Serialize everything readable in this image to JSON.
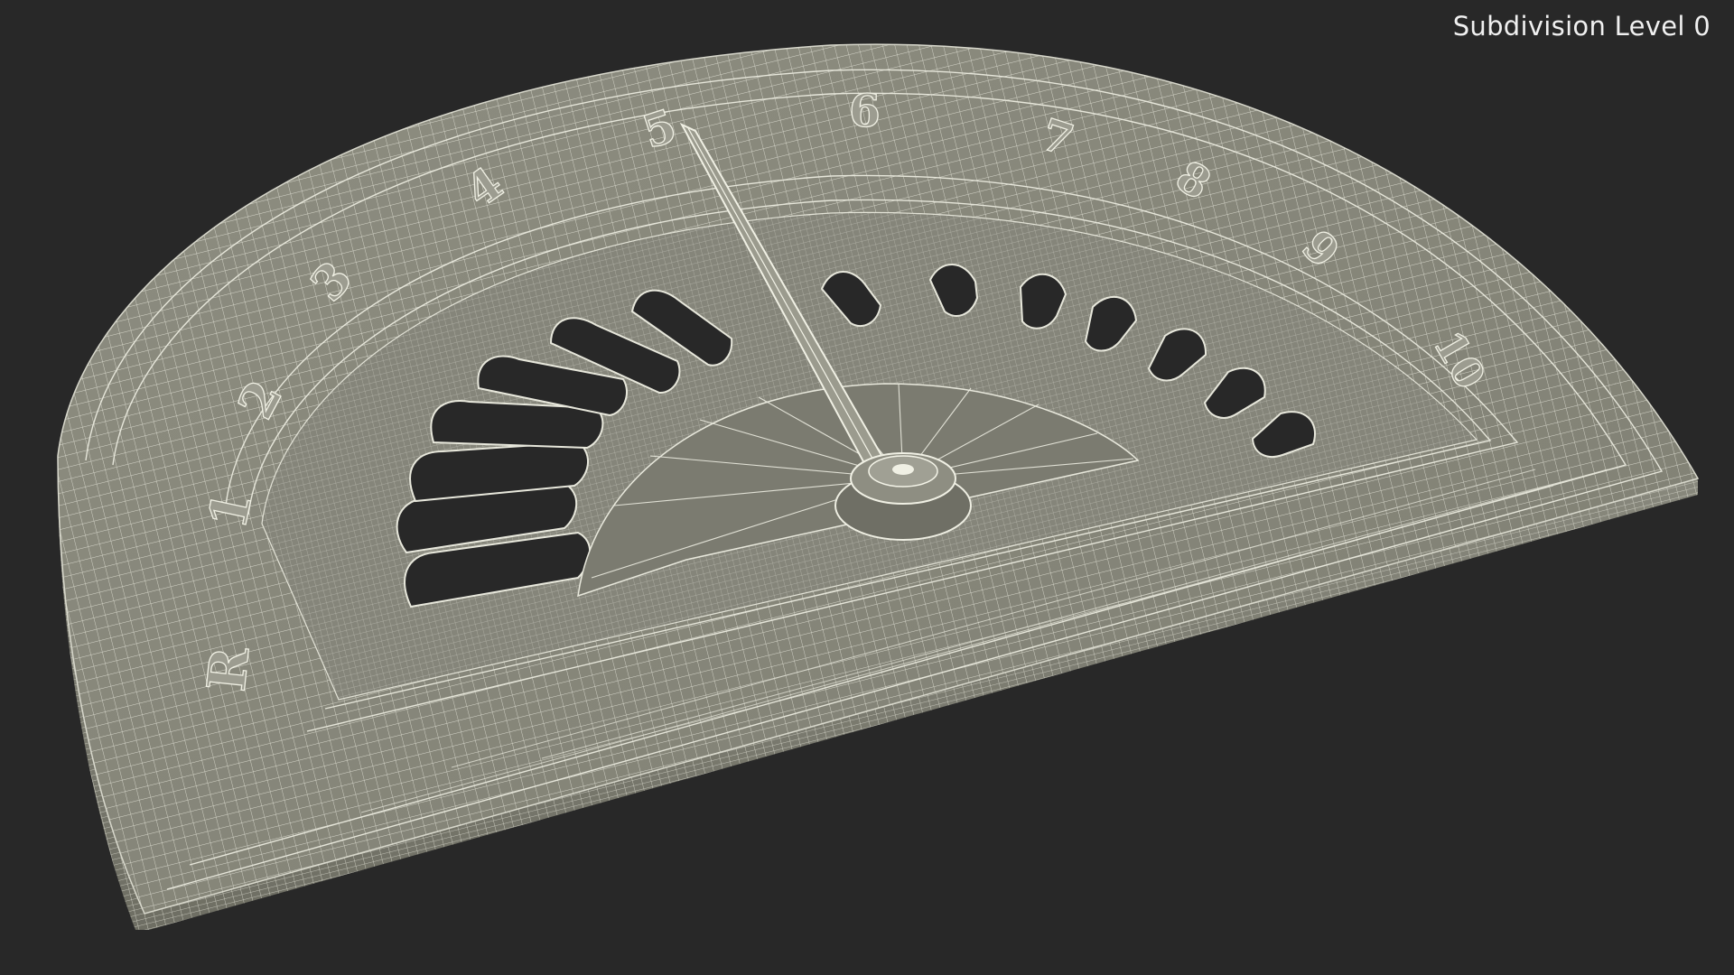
{
  "viewport": {
    "label": "Subdivision Level 0",
    "background_color": "#282828",
    "model_color": "#8a8a7c",
    "wire_color": "#e8e8dc"
  },
  "model": {
    "name": "sundial-dial-plate",
    "numerals": [
      "R",
      "1",
      "2",
      "3",
      "4",
      "5",
      "6",
      "7",
      "8",
      "9",
      "10"
    ]
  }
}
